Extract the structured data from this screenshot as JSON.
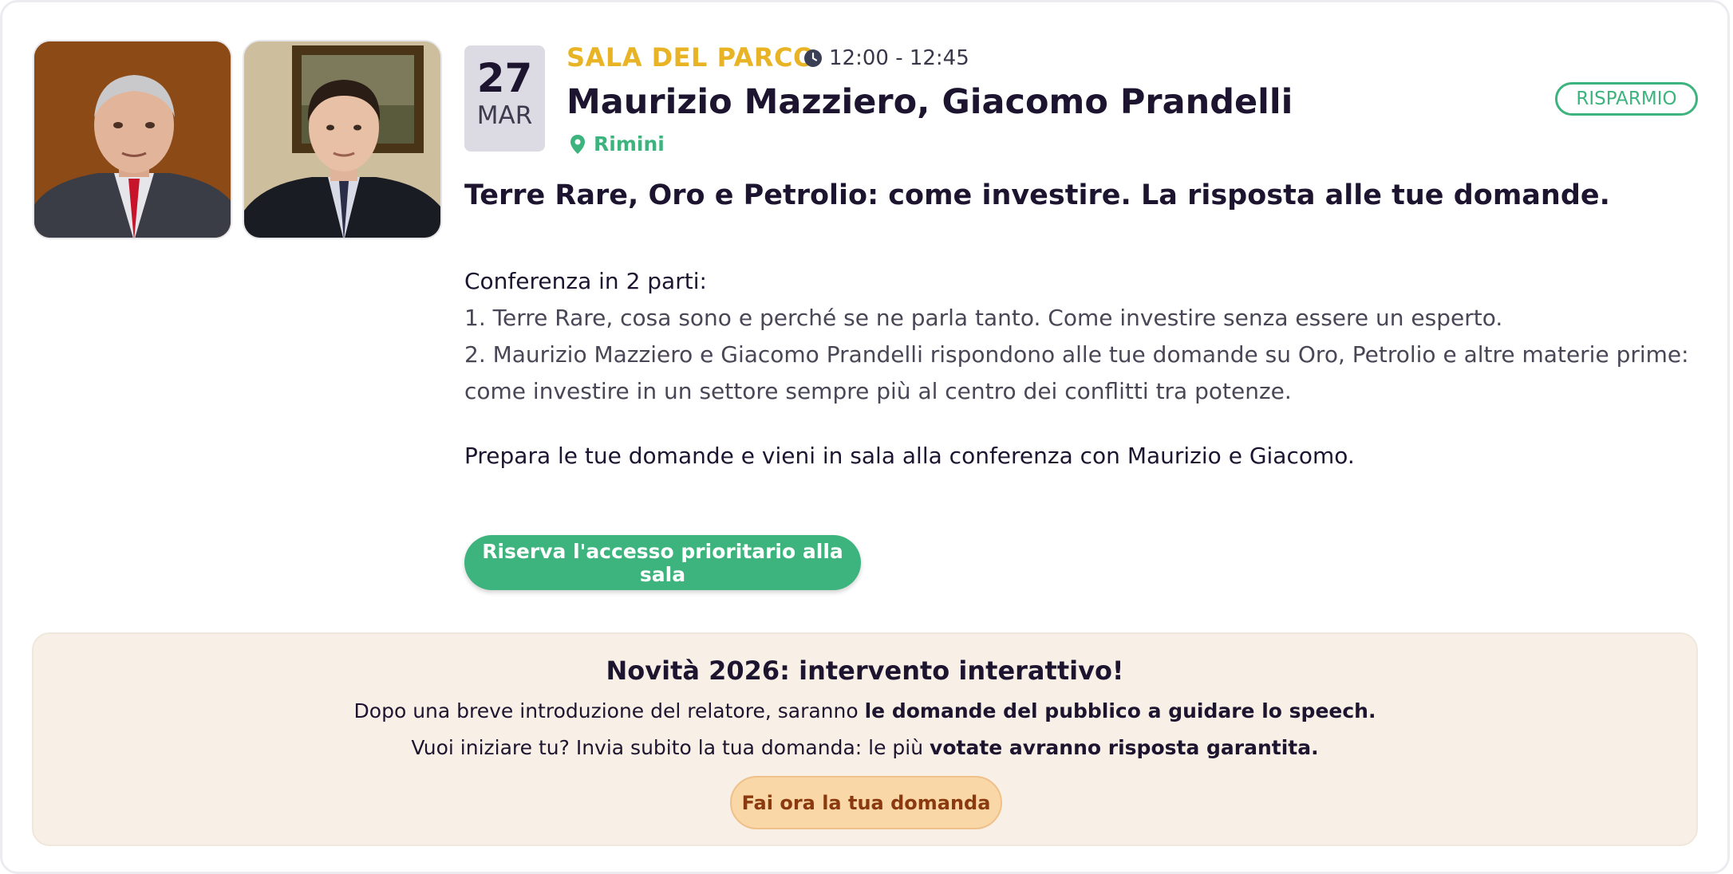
{
  "event": {
    "date_day": "27",
    "date_month": "MAR",
    "room": "SALA DEL PARCO",
    "time": "12:00 - 12:45",
    "speakers": "Maurizio Mazziero, Giacomo Prandelli",
    "location": "Rimini",
    "tag": "RISPARMIO",
    "title": "Terre Rare, Oro e Petrolio: come investire. La risposta alle tue domande.",
    "description": {
      "intro": "Conferenza in 2 parti:",
      "lines": [
        "1. Terre Rare, cosa sono e perché se ne parla tanto. Come investire senza essere un esperto.",
        "2. Maurizio Mazziero e Giacomo Prandelli rispondono alle tue domande su Oro, Petrolio e altre materie prime:",
        "come investire in un settore sempre più al centro dei conflitti tra potenze."
      ],
      "closing": "Prepara le tue domande e vieni in sala alla conferenza con Maurizio e Giacomo."
    },
    "cta_label": "Riserva l'accesso prioritario alla sala"
  },
  "novita": {
    "title": "Novità 2026: intervento interattivo!",
    "line1_normal": "Dopo una breve introduzione del relatore, saranno ",
    "line1_bold": "le domande del pubblico a guidare lo speech.",
    "line2_normal": "Vuoi iniziare tu? Invia subito la tua domanda: le più ",
    "line2_bold": "votate avranno risposta garantita.",
    "button_label": "Fai ora la tua domanda"
  },
  "colors": {
    "accent_green": "#3db47e",
    "room_yellow": "#e8b425",
    "panel_beige": "#f8f0e6",
    "button_peach": "#f9d7a6"
  },
  "icons": {
    "time": "clock-icon",
    "location": "map-pin-icon"
  }
}
